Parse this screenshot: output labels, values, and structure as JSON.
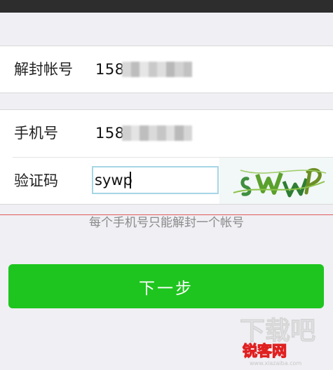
{
  "form": {
    "unblock_account": {
      "label": "解封帐号",
      "value": "158"
    },
    "phone": {
      "label": "手机号",
      "value": "158"
    },
    "captcha": {
      "label": "验证码",
      "input_value": "sywp"
    },
    "hint": "每个手机号只能解封一个帐号"
  },
  "actions": {
    "next_label": "下一步"
  },
  "watermark": {
    "text_top": "下载吧",
    "text_bottom": "锐客网",
    "url": "www.xiazaiba.com"
  },
  "colors": {
    "accent_green": "#1ec51e",
    "error_red": "#e05a5a",
    "input_focus_border": "#a6d6e6"
  }
}
